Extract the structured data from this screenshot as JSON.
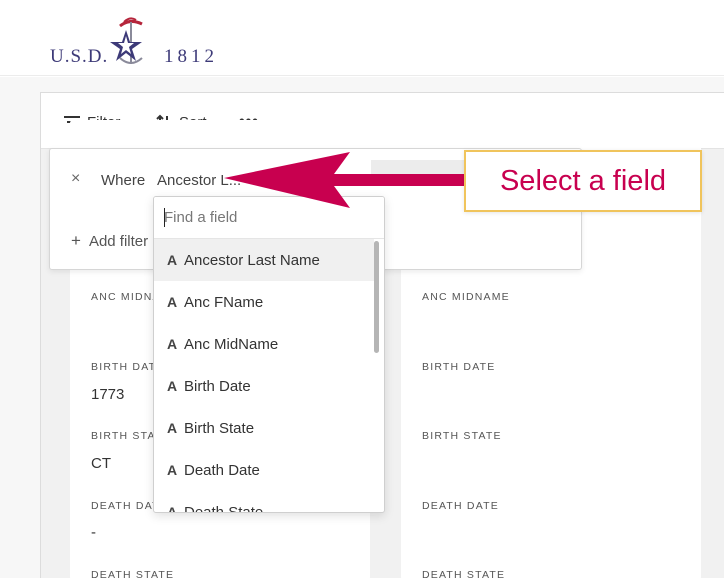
{
  "logo": {
    "left_text": "U.S.D.",
    "right_text": "1812"
  },
  "toolbar": {
    "filter_label": "Filter",
    "sort_label": "Sort",
    "more_label": "•••"
  },
  "filter_popover": {
    "close_label": "×",
    "where_label": "Where",
    "selected_field": "Ancestor L...",
    "add_filter_label": "Add filter"
  },
  "dropdown": {
    "search_placeholder": "Find a field",
    "type_glyph": "A",
    "items": [
      {
        "label": "Ancestor Last Name",
        "active": true
      },
      {
        "label": "Anc FName"
      },
      {
        "label": "Anc MidName"
      },
      {
        "label": "Birth Date"
      },
      {
        "label": "Birth State"
      },
      {
        "label": "Death Date"
      },
      {
        "label": "Death State"
      }
    ]
  },
  "left_card": {
    "fields": [
      {
        "label": "ANC MIDNAME",
        "value": ""
      },
      {
        "label": "BIRTH DATE",
        "value": "1773"
      },
      {
        "label": "BIRTH STATE",
        "value": "CT"
      },
      {
        "label": "DEATH DATE",
        "value": "-"
      },
      {
        "label": "DEATH STATE",
        "value": ""
      }
    ]
  },
  "right_card": {
    "fields": [
      {
        "label": "ANC MIDNAME",
        "value": ""
      },
      {
        "label": "BIRTH DATE",
        "value": ""
      },
      {
        "label": "BIRTH STATE",
        "value": ""
      },
      {
        "label": "DEATH DATE",
        "value": ""
      },
      {
        "label": "DEATH STATE",
        "value": ""
      }
    ]
  },
  "callout": {
    "text": "Select a field"
  },
  "colors": {
    "accent_arrow": "#c8004f",
    "callout_border": "#f0c45c",
    "logo_navy": "#3d3a78",
    "logo_red": "#b5253b"
  }
}
